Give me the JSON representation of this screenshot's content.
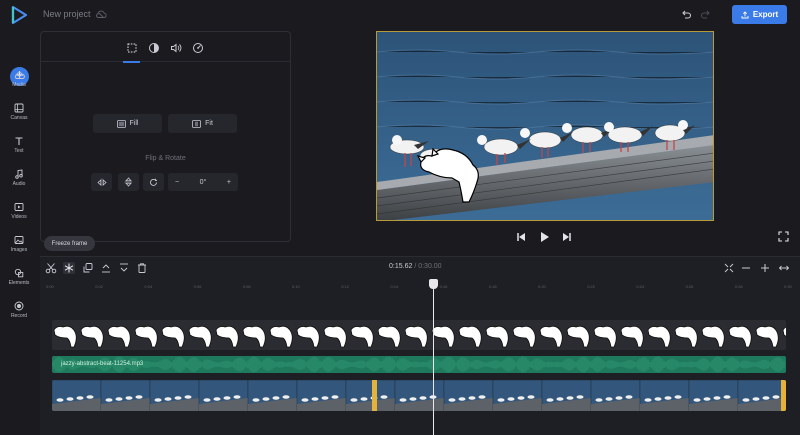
{
  "header": {
    "project_title": "New project",
    "export_label": "Export",
    "accent_color": "#3a7be8"
  },
  "sidebar": {
    "add_icon": "plus-icon",
    "items": [
      {
        "label": "Media",
        "icon": "upload-cloud-icon"
      },
      {
        "label": "Canvas",
        "icon": "canvas-icon"
      },
      {
        "label": "Text",
        "icon": "text-icon"
      },
      {
        "label": "Audio",
        "icon": "music-note-icon"
      },
      {
        "label": "Videos",
        "icon": "video-icon"
      },
      {
        "label": "Images",
        "icon": "image-icon"
      },
      {
        "label": "Elements",
        "icon": "shapes-icon"
      },
      {
        "label": "Record",
        "icon": "record-icon"
      }
    ]
  },
  "properties": {
    "tabs": [
      {
        "icon": "crop-icon",
        "active": true
      },
      {
        "icon": "contrast-icon",
        "active": false
      },
      {
        "icon": "volume-icon",
        "active": false
      },
      {
        "icon": "speed-icon",
        "active": false
      }
    ],
    "fill_label": "Fill",
    "fit_label": "Fit",
    "flip_rotate_title": "Flip & Rotate",
    "rotation_value": "0°",
    "minus_label": "−",
    "plus_label": "+"
  },
  "tooltip": {
    "text": "Freeze frame"
  },
  "timeline": {
    "current_time": "0:15.62",
    "separator": "/",
    "total_time": "0:30.00",
    "ruler_ticks": [
      "0:00",
      "0:02",
      "0:04",
      "0:06",
      "0:08",
      "0:10",
      "0:12",
      "0:14",
      "0:16",
      "0:18",
      "0:20",
      "0:22",
      "0:24",
      "0:26",
      "0:28",
      "0:30"
    ],
    "audio_track_name": "jazzy-abstract-beat-11254.mp3",
    "zoom_minus": "−",
    "zoom_plus": "+"
  }
}
